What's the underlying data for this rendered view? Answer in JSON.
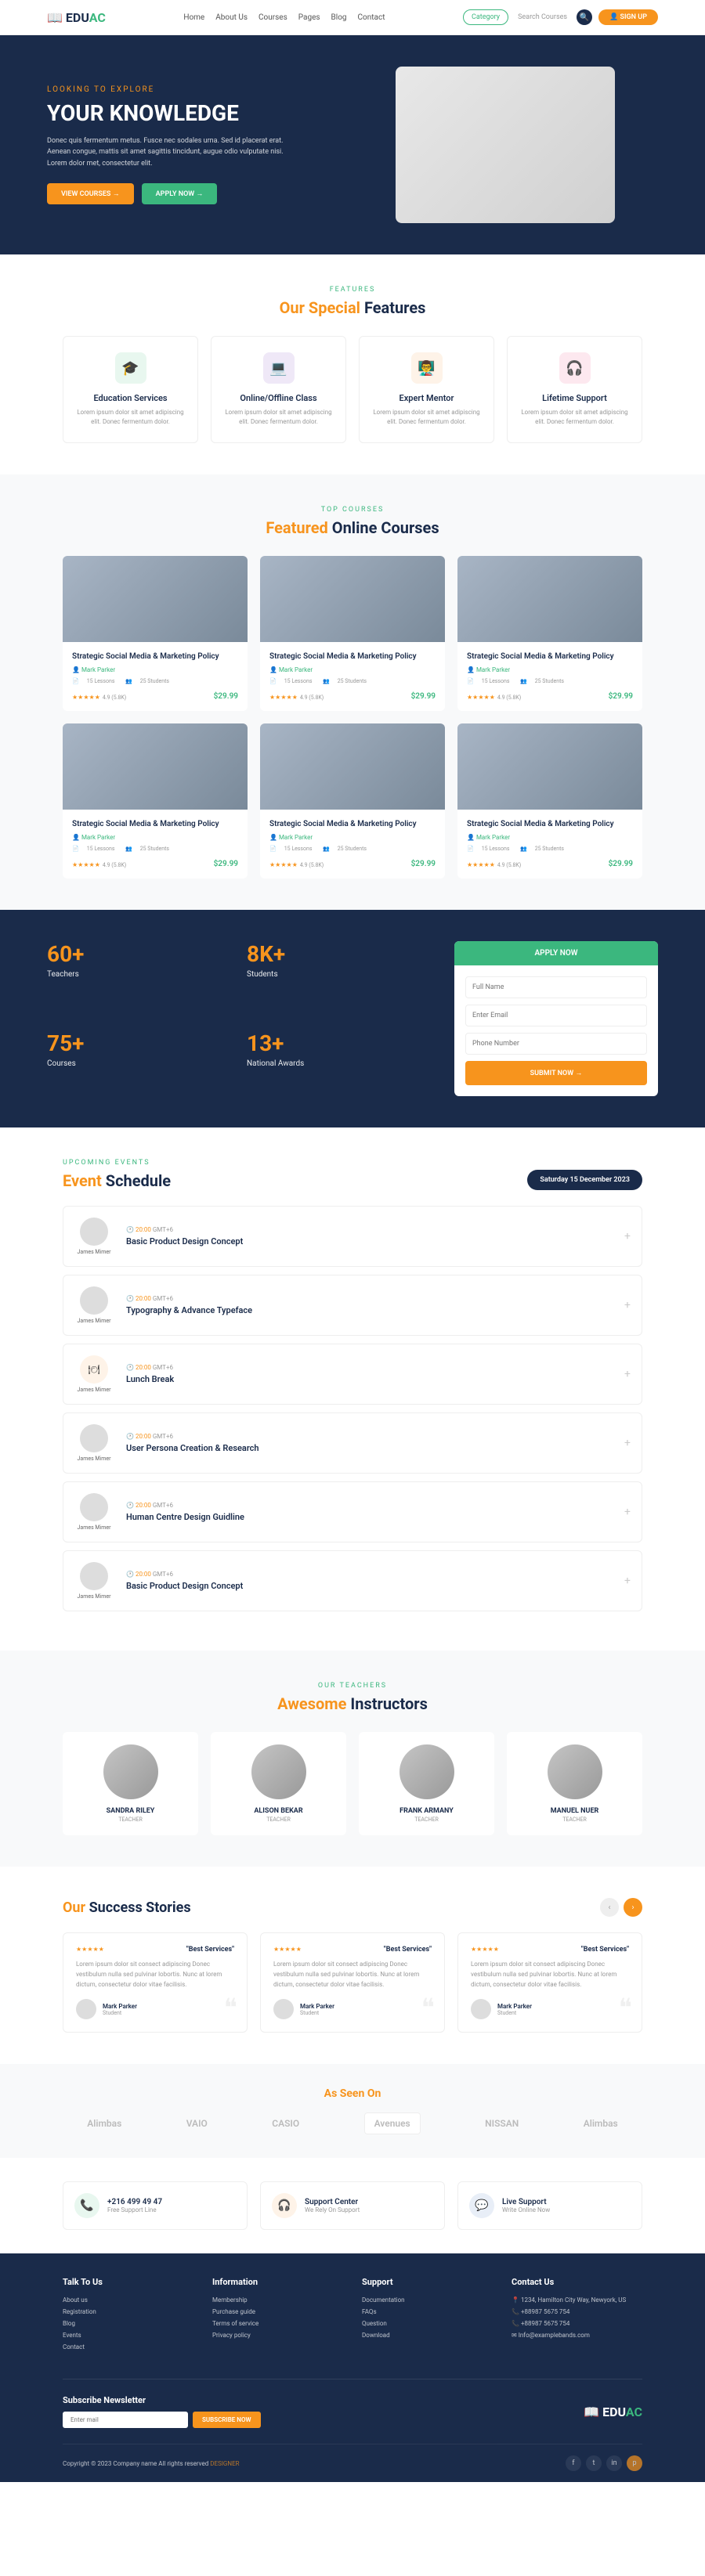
{
  "header": {
    "logo": {
      "edu": "EDU",
      "ac": "AC"
    },
    "nav": [
      "Home",
      "About Us",
      "Courses",
      "Pages",
      "Blog",
      "Contact"
    ],
    "category_label": "Category",
    "search_placeholder": "Search Courses",
    "signup_label": "SIGN UP"
  },
  "hero": {
    "subtitle": "LOOKING TO EXPLORE",
    "title": "YOUR KNOWLEDGE",
    "desc": "Donec quis fermentum metus. Fusce nec sodales urna. Sed id placerat erat. Aenean congue, mattis sit amet sagittis tincidunt, augue odio vulputate nisi. Lorem dolor met, consectetur elit.",
    "btn1": "VIEW COURSES →",
    "btn2": "APPLY NOW →"
  },
  "features": {
    "sub": "FEATURES",
    "title_accent": "Our Special",
    "title_rest": "Features",
    "items": [
      {
        "title": "Education Services",
        "desc": "Lorem ipsum dolor sit amet adipiscing elit. Donec fermentum dolor."
      },
      {
        "title": "Online/Offline Class",
        "desc": "Lorem ipsum dolor sit amet adipiscing elit. Donec fermentum dolor."
      },
      {
        "title": "Expert Mentor",
        "desc": "Lorem ipsum dolor sit amet adipiscing elit. Donec fermentum dolor."
      },
      {
        "title": "Lifetime Support",
        "desc": "Lorem ipsum dolor sit amet adipiscing elit. Donec fermentum dolor."
      }
    ]
  },
  "courses": {
    "sub": "TOP COURSES",
    "title_accent": "Featured",
    "title_rest": "Online Courses",
    "items": [
      {
        "title": "Strategic Social Media & Marketing Policy",
        "author": "Mark Parker",
        "lessons": "15 Lessons",
        "students": "25 Students",
        "rating": "4.9 (5.8K)",
        "price": "$29.99"
      },
      {
        "title": "Strategic Social Media & Marketing Policy",
        "author": "Mark Parker",
        "lessons": "15 Lessons",
        "students": "25 Students",
        "rating": "4.9 (5.8K)",
        "price": "$29.99"
      },
      {
        "title": "Strategic Social Media & Marketing Policy",
        "author": "Mark Parker",
        "lessons": "15 Lessons",
        "students": "25 Students",
        "rating": "4.9 (5.8K)",
        "price": "$29.99"
      },
      {
        "title": "Strategic Social Media & Marketing Policy",
        "author": "Mark Parker",
        "lessons": "15 Lessons",
        "students": "25 Students",
        "rating": "4.9 (5.8K)",
        "price": "$29.99"
      },
      {
        "title": "Strategic Social Media & Marketing Policy",
        "author": "Mark Parker",
        "lessons": "15 Lessons",
        "students": "25 Students",
        "rating": "4.9 (5.8K)",
        "price": "$29.99"
      },
      {
        "title": "Strategic Social Media & Marketing Policy",
        "author": "Mark Parker",
        "lessons": "15 Lessons",
        "students": "25 Students",
        "rating": "4.9 (5.8K)",
        "price": "$29.99"
      }
    ]
  },
  "stats": {
    "items": [
      {
        "num": "60+",
        "label": "Teachers"
      },
      {
        "num": "8K+",
        "label": "Students"
      },
      {
        "num": "75+",
        "label": "Courses"
      },
      {
        "num": "13+",
        "label": "National Awards"
      }
    ],
    "form": {
      "header": "APPLY NOW",
      "placeholders": [
        "Full Name",
        "Enter Email",
        "Phone Number"
      ],
      "btn": "SUBMIT NOW →"
    }
  },
  "events": {
    "sub": "UPCOMING EVENTS",
    "title_accent": "Event",
    "title_rest": "Schedule",
    "date": "Saturday 15 December 2023",
    "items": [
      {
        "time": "20:00",
        "tz": "GMT+6",
        "title": "Basic Product Design Concept",
        "name": "James Mimer"
      },
      {
        "time": "20:00",
        "tz": "GMT+6",
        "title": "Typography & Advance Typeface",
        "name": "James Mimer"
      },
      {
        "time": "20:00",
        "tz": "GMT+6",
        "title": "Lunch Break",
        "name": "James Mimer"
      },
      {
        "time": "20:00",
        "tz": "GMT+6",
        "title": "User Persona Creation & Research",
        "name": "James Mimer"
      },
      {
        "time": "20:00",
        "tz": "GMT+6",
        "title": "Human Centre Design Guidline",
        "name": "James Mimer"
      },
      {
        "time": "20:00",
        "tz": "GMT+6",
        "title": "Basic Product Design Concept",
        "name": "James Mimer"
      }
    ]
  },
  "instructors": {
    "sub": "OUR TEACHERS",
    "title_accent": "Awesome",
    "title_rest": "Instructors",
    "items": [
      {
        "name": "SANDRA RILEY",
        "role": "TEACHER"
      },
      {
        "name": "ALISON BEKAR",
        "role": "TEACHER"
      },
      {
        "name": "FRANK ARMANY",
        "role": "TEACHER"
      },
      {
        "name": "MANUEL NUER",
        "role": "TEACHER"
      }
    ]
  },
  "testimonials": {
    "title_accent": "Our",
    "title_rest": "Success Stories",
    "items": [
      {
        "label": "\"Best Services\"",
        "text": "Lorem ipsum dolor sit consect adipiscing Donec vestibulum nulla sed pulvinar lobortis. Nunc at lorem dictum, consectetur dolor vitae facilisis.",
        "name": "Mark Parker",
        "role": "Student"
      },
      {
        "label": "\"Best Services\"",
        "text": "Lorem ipsum dolor sit consect adipiscing Donec vestibulum nulla sed pulvinar lobortis. Nunc at lorem dictum, consectetur dolor vitae facilisis.",
        "name": "Mark Parker",
        "role": "Student"
      },
      {
        "label": "\"Best Services\"",
        "text": "Lorem ipsum dolor sit consect adipiscing Donec vestibulum nulla sed pulvinar lobortis. Nunc at lorem dictum, consectetur dolor vitae facilisis.",
        "name": "Mark Parker",
        "role": "Student"
      }
    ]
  },
  "partners": {
    "title": "As Seen On",
    "items": [
      "Alimbas",
      "VAIO",
      "CASIO",
      "Avenues",
      "NISSAN",
      "Alimbas"
    ]
  },
  "contact": {
    "items": [
      {
        "title": "+216 499 49 47",
        "sub": "Free Support Line"
      },
      {
        "title": "Support Center",
        "sub": "We Rely On Support"
      },
      {
        "title": "Live Support",
        "sub": "Write Online Now"
      }
    ]
  },
  "footer": {
    "cols": [
      {
        "title": "Talk To Us",
        "items": [
          "About us",
          "Registration",
          "Blog",
          "Events",
          "Contact"
        ]
      },
      {
        "title": "Information",
        "items": [
          "Membership",
          "Purchase guide",
          "Terms of service",
          "Privacy policy"
        ]
      },
      {
        "title": "Support",
        "items": [
          "Documentation",
          "FAQs",
          "Question",
          "Download"
        ]
      },
      {
        "title": "Contact Us",
        "items": [
          "📍 1234, Hamilton City Way, Newyork, US",
          "📞 +88987 5675 754",
          "📞 +88987 5675 754",
          "✉ Info@examplebands.com"
        ]
      }
    ],
    "newsletter": {
      "title": "Subscribe Newsletter",
      "placeholder": "Enter mail",
      "btn": "SUBSCRIBE NOW"
    },
    "logo": {
      "edu": "EDU",
      "ac": "AC"
    },
    "copyright": "Copyright © 2023 Company name All rights reserved",
    "designby": "DESIGNER"
  }
}
